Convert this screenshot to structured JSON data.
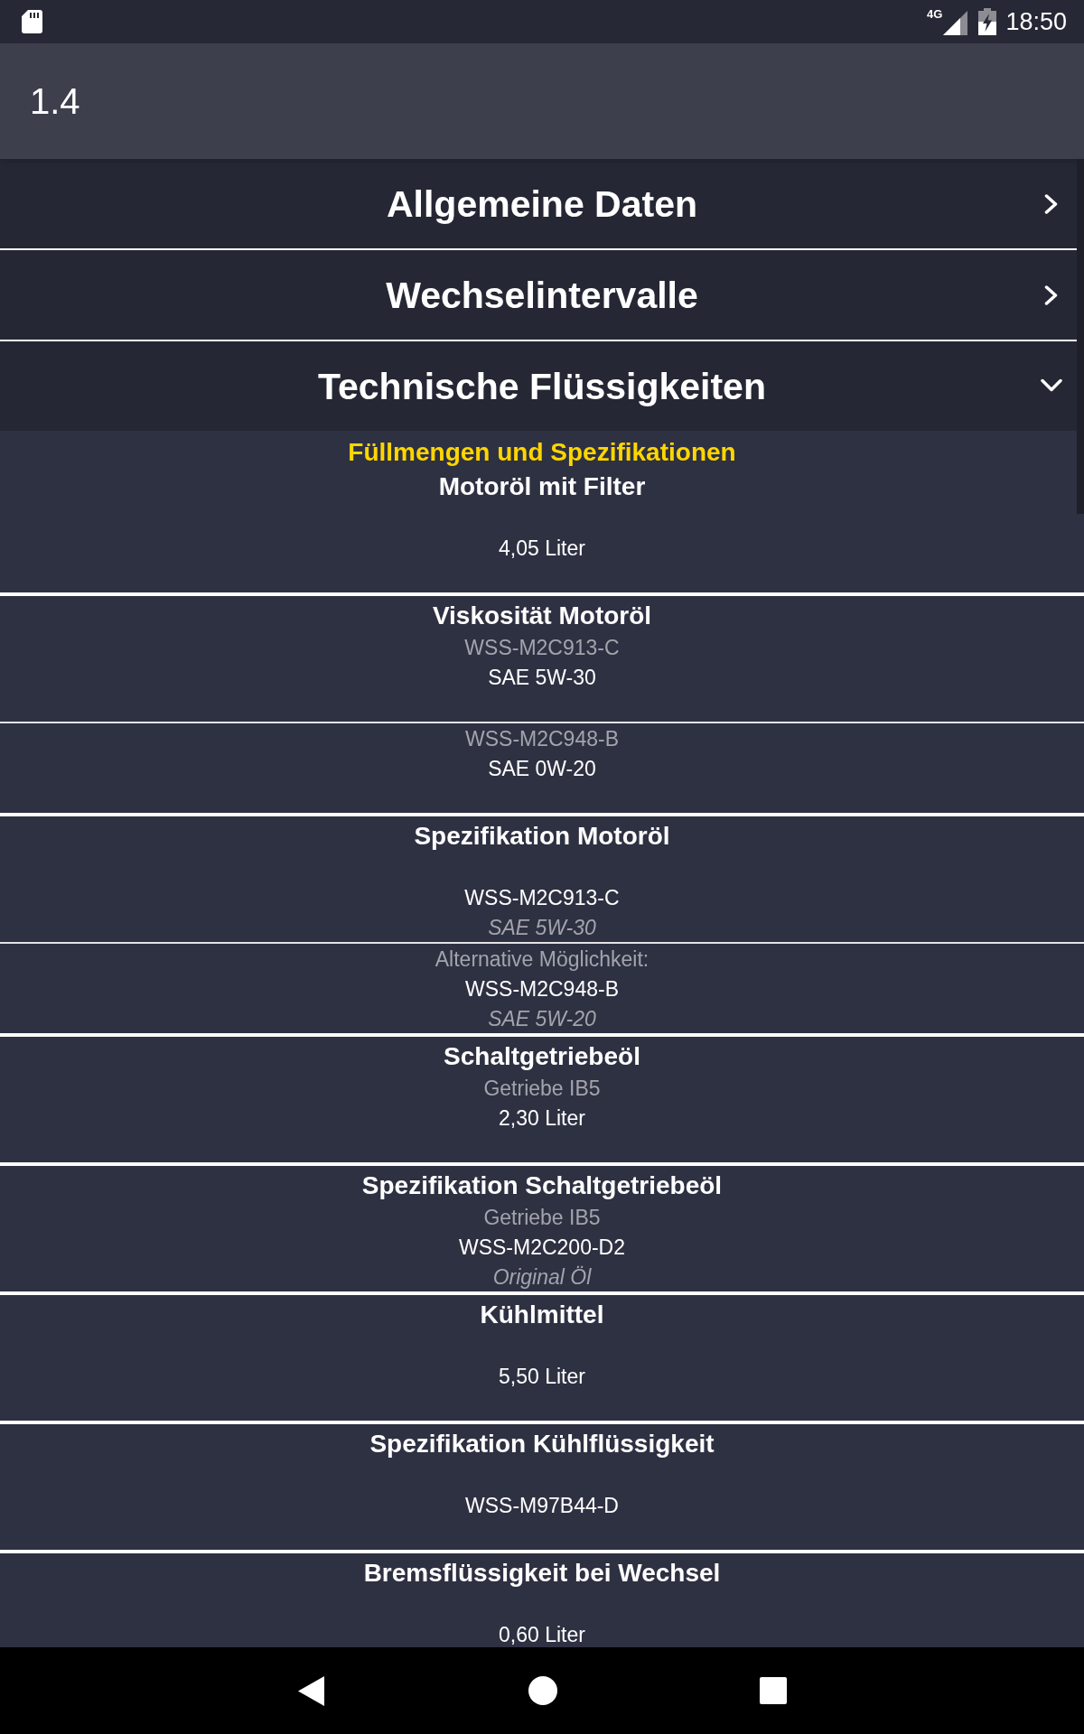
{
  "status_bar": {
    "network": "4G",
    "time": "18:50"
  },
  "app_bar": {
    "title": "1.4"
  },
  "sections": [
    {
      "title": "Allgemeine Daten",
      "expanded": false
    },
    {
      "title": "Wechselintervalle",
      "expanded": false
    },
    {
      "title": "Technische Flüssigkeiten",
      "expanded": true,
      "content": {
        "heading": "Füllmengen und Spezifikationen",
        "groups": [
          {
            "title": "Motoröl mit Filter",
            "entries": [
              {
                "value": "4,05 Liter"
              }
            ]
          },
          {
            "title": "Viskosität Motoröl",
            "entries": [
              {
                "label": "WSS-M2C913-C",
                "value": "SAE 5W-30"
              },
              {
                "label": "WSS-M2C948-B",
                "value": "SAE 0W-20"
              }
            ]
          },
          {
            "title": "Spezifikation Motoröl",
            "entries": [
              {
                "value": "WSS-M2C913-C",
                "note": "SAE 5W-30"
              },
              {
                "label": "Alternative Möglichkeit:",
                "value": "WSS-M2C948-B",
                "note": "SAE 5W-20"
              }
            ]
          },
          {
            "title": "Schaltgetriebeöl",
            "entries": [
              {
                "label": "Getriebe IB5",
                "value": "2,30 Liter"
              }
            ]
          },
          {
            "title": "Spezifikation Schaltgetriebeöl",
            "entries": [
              {
                "label": "Getriebe IB5",
                "value": "WSS-M2C200-D2",
                "note": "Original Öl"
              }
            ]
          },
          {
            "title": "Kühlmittel",
            "entries": [
              {
                "value": "5,50 Liter"
              }
            ]
          },
          {
            "title": "Spezifikation Kühlflüssigkeit",
            "entries": [
              {
                "value": "WSS-M97B44-D"
              }
            ]
          },
          {
            "title": "Bremsflüssigkeit bei Wechsel",
            "entries": [
              {
                "value": "0,60 Liter"
              }
            ]
          }
        ]
      }
    }
  ]
}
